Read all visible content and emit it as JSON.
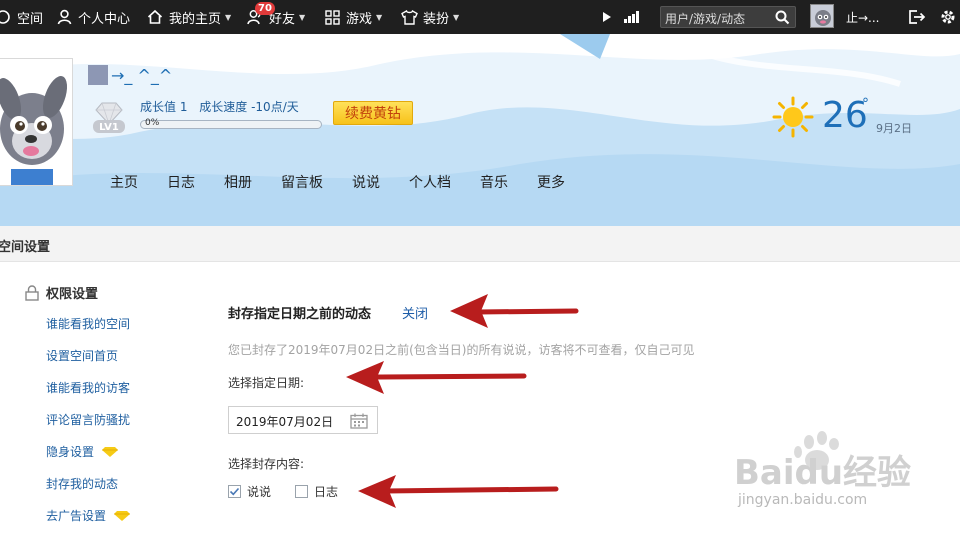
{
  "topbar": {
    "logo_text": "空间",
    "personal_center": "个人中心",
    "my_homepage": "我的主页",
    "friends": "好友",
    "friends_badge": "70",
    "games": "游戏",
    "dressup": "装扮",
    "search_placeholder": "用户/游戏/动态",
    "username": "止→..."
  },
  "header": {
    "nickname": "→_ ^_^",
    "level": "LV1",
    "growth_value": "成长值 1",
    "growth_speed": "成长速度 -10点/天",
    "progress_label": "0%",
    "progress_value": 0,
    "renew_button": "续费黄钻",
    "temperature": "26",
    "date": "9月2日",
    "nav": [
      "主页",
      "日志",
      "相册",
      "留言板",
      "说说",
      "个人档",
      "音乐",
      "更多"
    ]
  },
  "settings_bar": {
    "title": "空间设置"
  },
  "sidebar": {
    "title": "权限设置",
    "items": [
      {
        "label": "谁能看我的空间",
        "gem": false
      },
      {
        "label": "设置空间首页",
        "gem": false
      },
      {
        "label": "谁能看我的访客",
        "gem": false
      },
      {
        "label": "评论留言防骚扰",
        "gem": false
      },
      {
        "label": "隐身设置",
        "gem": true
      },
      {
        "label": "封存我的动态",
        "gem": false
      },
      {
        "label": "去广告设置",
        "gem": true
      }
    ]
  },
  "main": {
    "section_title": "封存指定日期之前的动态",
    "close_link": "关闭",
    "description": "您已封存了2019年07月02日之前(包含当日)的所有说说，访客将不可查看，仅自己可见",
    "date_label": "选择指定日期:",
    "date_value": "2019年07月02日",
    "content_label": "选择封存内容:",
    "options": [
      {
        "label": "说说",
        "checked": true
      },
      {
        "label": "日志",
        "checked": false
      }
    ]
  },
  "watermark": {
    "brand": "Baidu经验",
    "url": "jingyan.baidu.com"
  },
  "colors": {
    "topbar_bg": "#1f1f1f",
    "link_blue": "#1f5fa0",
    "arrow_red": "#b81d1d",
    "renew_gold": "#f7c21a"
  }
}
